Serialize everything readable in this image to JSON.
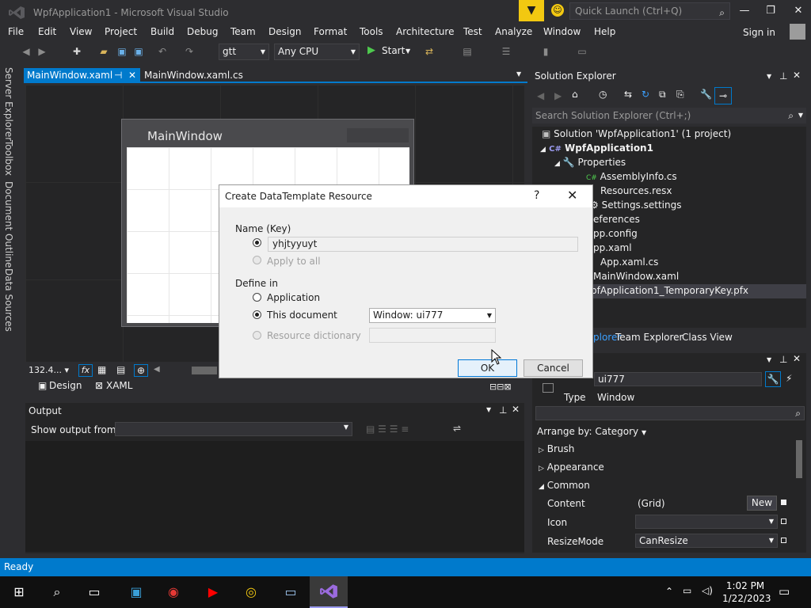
{
  "window": {
    "title": "WpfApplication1 - Microsoft Visual Studio"
  },
  "quick_launch": {
    "placeholder": "Quick Launch (Ctrl+Q)"
  },
  "menu": {
    "items": [
      "File",
      "Edit",
      "View",
      "Project",
      "Build",
      "Debug",
      "Team",
      "Design",
      "Format",
      "Tools",
      "Architecture",
      "Test",
      "Analyze",
      "Window",
      "Help"
    ],
    "signin": "Sign in"
  },
  "toolbar": {
    "config": "gtt",
    "platform": "Any CPU",
    "start": "Start"
  },
  "left_tabs": [
    "Server Explorer",
    "Toolbox",
    "Document Outline",
    "Data Sources"
  ],
  "doc_tabs": {
    "active": "MainWindow.xaml",
    "inactive": "MainWindow.xaml.cs"
  },
  "designer": {
    "window_title": "MainWindow",
    "zoom": "132.4...",
    "tab_design": "Design",
    "tab_xaml": "XAML"
  },
  "output": {
    "title": "Output",
    "show_from": "Show output from:"
  },
  "solution_explorer": {
    "title": "Solution Explorer",
    "search_placeholder": "Search Solution Explorer (Ctrl+;)",
    "items": [
      "Solution 'WpfApplication1' (1 project)",
      "WpfApplication1",
      "Properties",
      "AssemblyInfo.cs",
      "Resources.resx",
      "Settings.settings",
      "eferences",
      "pp.config",
      "pp.xaml",
      "App.xaml.cs",
      "MainWindow.xaml",
      "/pfApplication1_TemporaryKey.pfx"
    ],
    "tabs": [
      "plorer",
      "Team Explorer",
      "Class View"
    ]
  },
  "properties": {
    "name_value": "ui777",
    "type_label": "Type",
    "type_value": "Window",
    "arrange_by": "Arrange by: Category",
    "categories": [
      "Brush",
      "Appearance",
      "Common"
    ],
    "rows": [
      {
        "label": "Content",
        "value": "(Grid)",
        "button": "New"
      },
      {
        "label": "Icon",
        "value": ""
      },
      {
        "label": "ResizeMode",
        "value": "CanResize"
      }
    ]
  },
  "status": {
    "text": "Ready"
  },
  "taskbar": {
    "time": "1:02 PM",
    "date": "1/22/2023"
  },
  "dialog": {
    "title": "Create DataTemplate Resource",
    "help": "?",
    "name_key_label": "Name (Key)",
    "name_value": "yhjtyyuyt",
    "apply_to_all": "Apply to all",
    "define_in_label": "Define in",
    "application": "Application",
    "this_document": "This document",
    "this_document_value": "Window: ui777",
    "resource_dictionary": "Resource dictionary",
    "ok": "OK",
    "cancel": "Cancel"
  }
}
